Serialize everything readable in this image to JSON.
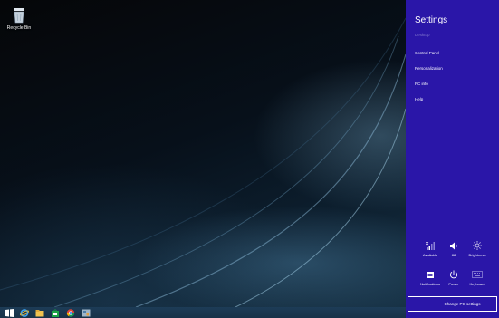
{
  "desktop": {
    "recycle_bin_label": "Recycle Bin"
  },
  "taskbar": {
    "apps": [
      "start",
      "internet-explorer",
      "file-explorer",
      "store",
      "chrome",
      "control-panel"
    ]
  },
  "charm": {
    "title": "Settings",
    "subtitle": "Desktop",
    "menu": [
      "Control Panel",
      "Personalization",
      "PC info",
      "Help"
    ],
    "quick": {
      "network": "Available",
      "volume": "88",
      "brightness": "Brightness",
      "notifications": "Notifications",
      "power": "Power",
      "keyboard": "Keyboard"
    },
    "change_pc_settings": "Change PC settings",
    "accent": "#2a16a8"
  }
}
